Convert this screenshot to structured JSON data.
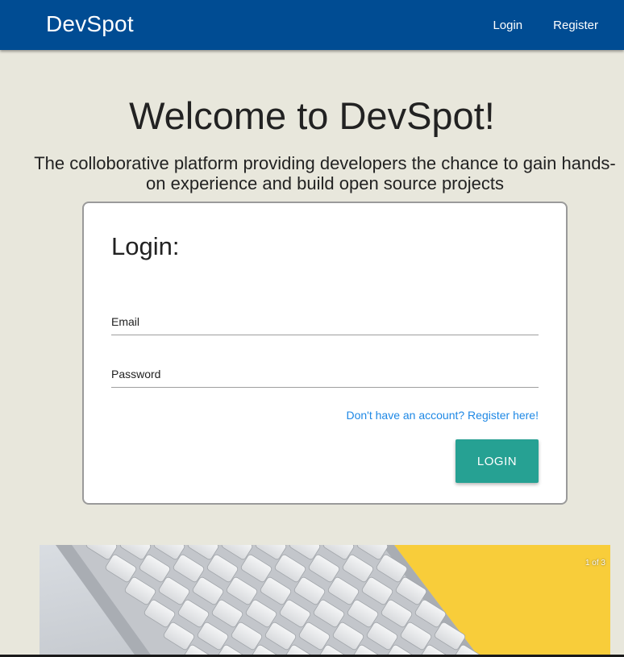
{
  "navbar": {
    "brand": "DevSpot",
    "links": [
      {
        "label": "Login"
      },
      {
        "label": "Register"
      }
    ],
    "background": "#004c93"
  },
  "hero": {
    "title": "Welcome to DevSpot!",
    "subtitle": "The colloborative platform providing developers the chance to gain hands-on experience and build open source projects"
  },
  "login_form": {
    "title": "Login:",
    "email_label": "Email",
    "email_value": "",
    "password_label": "Password",
    "password_value": "",
    "register_prompt": "Don't have an account? Register here!",
    "submit_label": "LOGIN",
    "submit_color": "#26a193",
    "link_color": "#1e88e5"
  },
  "carousel": {
    "counter": "1 of 3",
    "image": "keyboard-on-yellow-desk"
  }
}
